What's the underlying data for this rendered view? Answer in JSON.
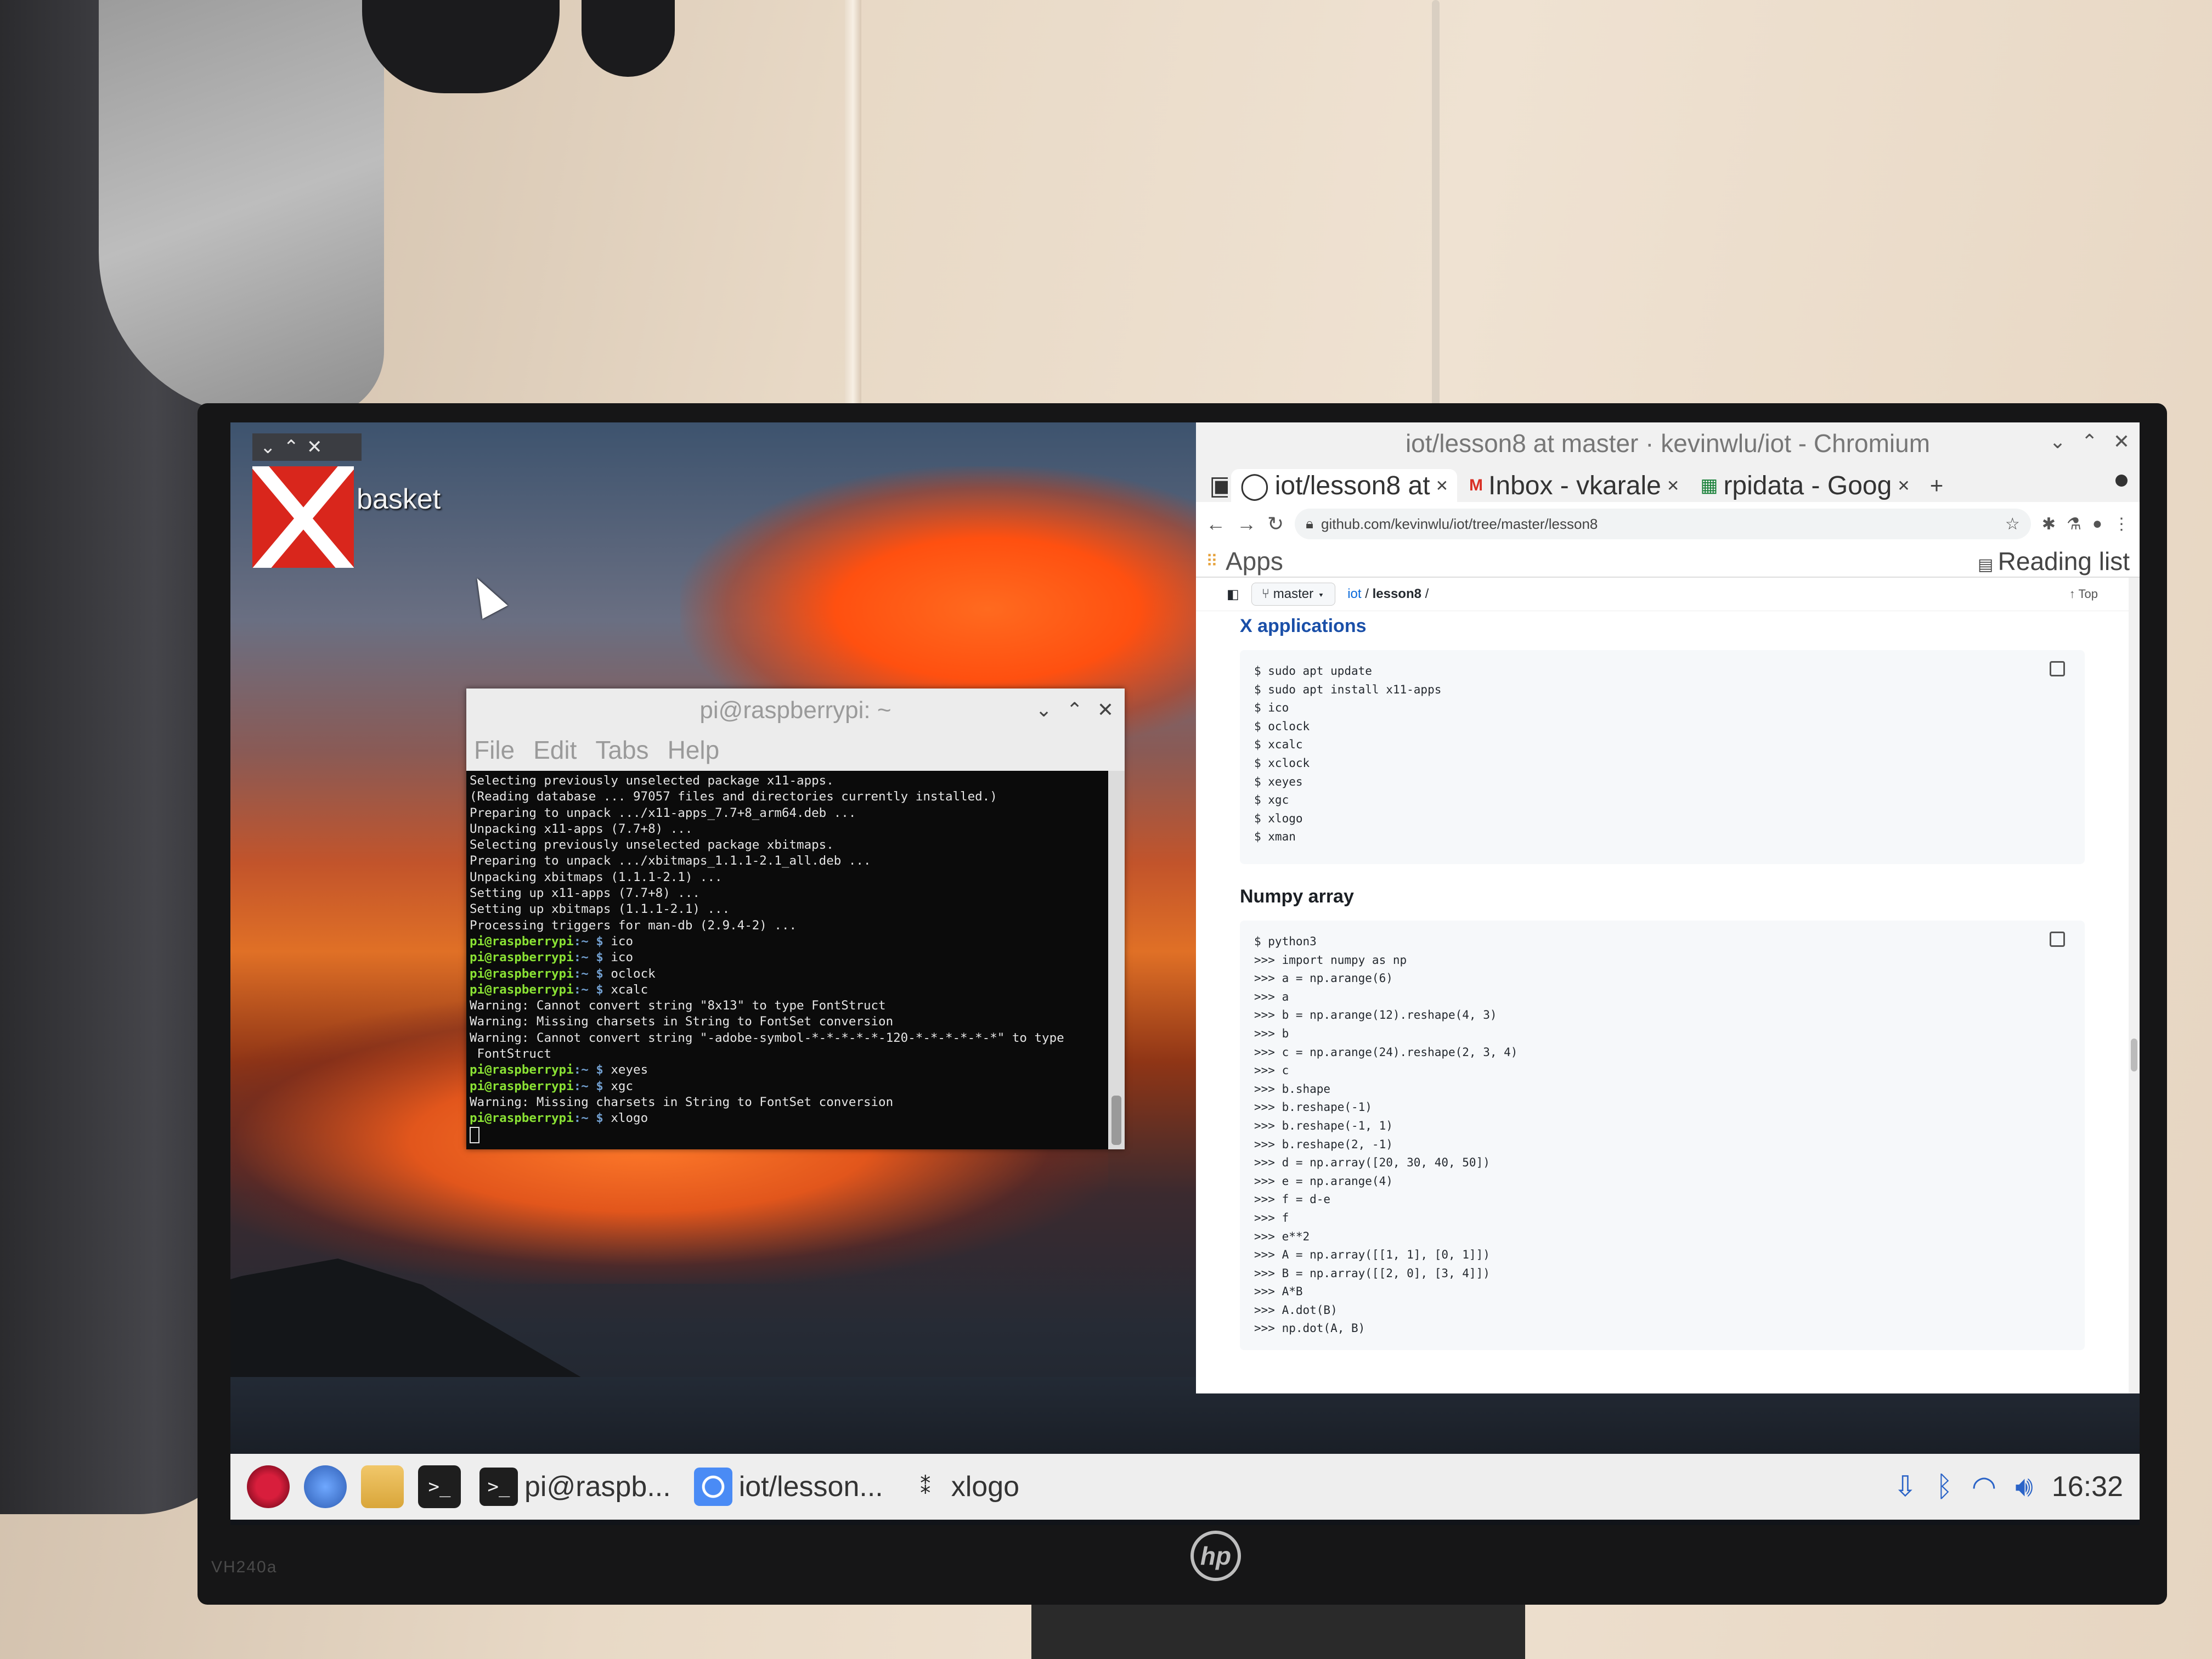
{
  "monitor": {
    "model": "VH240a",
    "brand": "hp"
  },
  "desktop": {
    "trash_label": "basket",
    "trash_controls": [
      "⌄",
      "⌃",
      "✕"
    ]
  },
  "terminal": {
    "title": "pi@raspberrypi: ~",
    "menu": [
      "File",
      "Edit",
      "Tabs",
      "Help"
    ],
    "lines": [
      {
        "t": "out",
        "text": "Selecting previously unselected package x11-apps."
      },
      {
        "t": "out",
        "text": "(Reading database ... 97057 files and directories currently installed.)"
      },
      {
        "t": "out",
        "text": "Preparing to unpack .../x11-apps_7.7+8_arm64.deb ..."
      },
      {
        "t": "out",
        "text": "Unpacking x11-apps (7.7+8) ..."
      },
      {
        "t": "out",
        "text": "Selecting previously unselected package xbitmaps."
      },
      {
        "t": "out",
        "text": "Preparing to unpack .../xbitmaps_1.1.1-2.1_all.deb ..."
      },
      {
        "t": "out",
        "text": "Unpacking xbitmaps (1.1.1-2.1) ..."
      },
      {
        "t": "out",
        "text": "Setting up x11-apps (7.7+8) ..."
      },
      {
        "t": "out",
        "text": "Setting up xbitmaps (1.1.1-2.1) ..."
      },
      {
        "t": "out",
        "text": "Processing triggers for man-db (2.9.4-2) ..."
      },
      {
        "t": "cmd",
        "user": "pi@raspberrypi",
        "path": ":~ $",
        "text": " ico"
      },
      {
        "t": "cmd",
        "user": "pi@raspberrypi",
        "path": ":~ $",
        "text": " ico"
      },
      {
        "t": "cmd",
        "user": "pi@raspberrypi",
        "path": ":~ $",
        "text": " oclock"
      },
      {
        "t": "cmd",
        "user": "pi@raspberrypi",
        "path": ":~ $",
        "text": " xcalc"
      },
      {
        "t": "out",
        "text": "Warning: Cannot convert string \"8x13\" to type FontStruct"
      },
      {
        "t": "out",
        "text": "Warning: Missing charsets in String to FontSet conversion"
      },
      {
        "t": "out",
        "text": "Warning: Cannot convert string \"-adobe-symbol-*-*-*-*-*-120-*-*-*-*-*-*\" to type"
      },
      {
        "t": "out",
        "text": " FontStruct"
      },
      {
        "t": "cmd",
        "user": "pi@raspberrypi",
        "path": ":~ $",
        "text": " xeyes"
      },
      {
        "t": "cmd",
        "user": "pi@raspberrypi",
        "path": ":~ $",
        "text": " xgc"
      },
      {
        "t": "out",
        "text": "Warning: Missing charsets in String to FontSet conversion"
      },
      {
        "t": "cmd",
        "user": "pi@raspberrypi",
        "path": ":~ $",
        "text": " xlogo"
      }
    ]
  },
  "browser": {
    "window_title": "iot/lesson8 at master · kevinwlu/iot - Chromium",
    "tabs": [
      {
        "icon": "github-icon",
        "label": "iot/lesson8 at",
        "active": true
      },
      {
        "icon": "gmail-icon",
        "label": "Inbox - vkarale",
        "active": false
      },
      {
        "icon": "sheets-icon",
        "label": "rpidata - Goog",
        "active": false
      }
    ],
    "url": "github.com/kevinwlu/iot/tree/master/lesson8",
    "bookmarks": {
      "apps": "Apps",
      "reading_list": "Reading list"
    },
    "repo_bar": {
      "branch": "master",
      "crumb_repo": "iot",
      "crumb_sep": "/",
      "crumb_dir": "lesson8",
      "crumb_end": "/",
      "top": "Top"
    },
    "section1": {
      "heading": "X applications",
      "code": "$ sudo apt update\n$ sudo apt install x11-apps\n$ ico\n$ oclock\n$ xcalc\n$ xclock\n$ xeyes\n$ xgc\n$ xlogo\n$ xman"
    },
    "section2": {
      "heading": "Numpy array",
      "code": "$ python3\n>>> import numpy as np\n>>> a = np.arange(6)\n>>> a\n>>> b = np.arange(12).reshape(4, 3)\n>>> b\n>>> c = np.arange(24).reshape(2, 3, 4)\n>>> c\n>>> b.shape\n>>> b.reshape(-1)\n>>> b.reshape(-1, 1)\n>>> b.reshape(2, -1)\n>>> d = np.array([20, 30, 40, 50])\n>>> e = np.arange(4)\n>>> f = d-e\n>>> f\n>>> e**2\n>>> A = np.array([[1, 1], [0, 1]])\n>>> B = np.array([[2, 0], [3, 4]])\n>>> A*B\n>>> A.dot(B)\n>>> np.dot(A, B)"
    }
  },
  "taskbar": {
    "tasks": [
      {
        "name": "terminal-task",
        "label": "pi@raspb..."
      },
      {
        "name": "chromium-task",
        "label": "iot/lesson..."
      },
      {
        "name": "xlogo-task",
        "label": "xlogo"
      }
    ],
    "clock": "16:32"
  }
}
